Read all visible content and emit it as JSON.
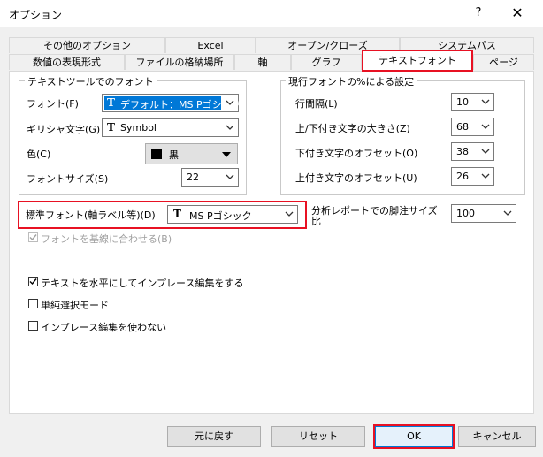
{
  "window": {
    "title": "オプション",
    "help": "?",
    "close": "✕"
  },
  "tabs_row1": [
    "その他のオプション",
    "Excel",
    "オープン/クローズ",
    "システムパス"
  ],
  "tabs_row2": [
    "数値の表現形式",
    "ファイルの格納場所",
    "軸",
    "グラフ",
    "テキストフォント",
    "ページ"
  ],
  "text_tool_group": {
    "title": "テキストツールでのフォント",
    "font_label": "フォント(F)",
    "font_value": "デフォルト：MS Pゴシック",
    "greek_label": "ギリシャ文字(G)",
    "greek_value": "Symbol",
    "color_label": "色(C)",
    "color_value": "黒",
    "color_swatch": "#000000",
    "size_label": "フォントサイズ(S)",
    "size_value": "22"
  },
  "percent_group": {
    "title": "現行フォントの%による設定",
    "line_spacing_label": "行間隔(L)",
    "line_spacing_value": "10",
    "sup_sub_size_label": "上/下付き文字の大きさ(Z)",
    "sup_sub_size_value": "68",
    "sub_offset_label": "下付き文字のオフセット(O)",
    "sub_offset_value": "38",
    "sup_offset_label": "上付き文字のオフセット(U)",
    "sup_offset_value": "26"
  },
  "standard_font": {
    "label": "標準フォント(軸ラベル等)(D)",
    "value": "MS Pゴシック"
  },
  "footnote": {
    "label": "分析レポートでの脚注サイズ比",
    "value": "100"
  },
  "checkboxes": {
    "baseline": "フォントを基線に合わせる(B)",
    "horizontal": "テキストを水平にしてインプレース編集をする",
    "single_select": "単純選択モード",
    "no_inplace": "インプレース編集を使わない"
  },
  "buttons": {
    "revert": "元に戻す",
    "reset": "リセット",
    "ok": "OK",
    "cancel": "キャンセル"
  },
  "colors": {
    "highlight": "#e81123",
    "selection": "#0078d7"
  }
}
